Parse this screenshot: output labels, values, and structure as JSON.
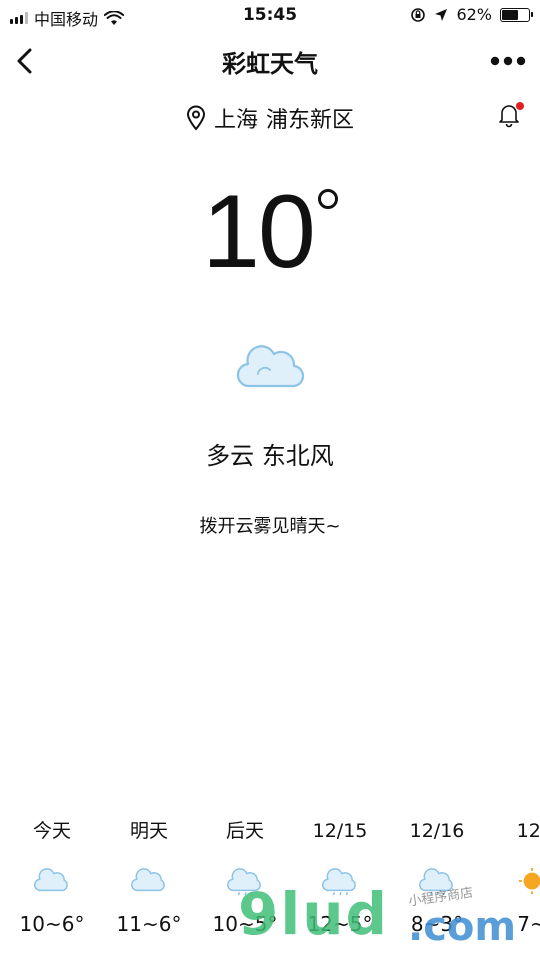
{
  "status_bar": {
    "carrier": "中国移动",
    "time": "15:45",
    "battery_percent": "62%",
    "battery_level": 0.62
  },
  "nav": {
    "title": "彩虹天气",
    "back_icon": "chevron-left-icon",
    "more_icon": "more-dots-icon"
  },
  "location": {
    "city": "上海",
    "district": "浦东新区"
  },
  "current": {
    "temperature": "10",
    "condition": "多云",
    "wind": "东北风",
    "quote": "拨开云雾见晴天~"
  },
  "forecast": [
    {
      "label": "今天",
      "icon": "cloud-icon",
      "range": "10~6°"
    },
    {
      "label": "明天",
      "icon": "cloud-icon",
      "range": "11~6°"
    },
    {
      "label": "后天",
      "icon": "rain-cloud-icon",
      "range": "10~5°"
    },
    {
      "label": "12/15",
      "icon": "rain-cloud-icon",
      "range": "12~5°"
    },
    {
      "label": "12/16",
      "icon": "rain-cloud-icon",
      "range": "8~3°"
    },
    {
      "label": "12/",
      "icon": "sun-icon",
      "range": "7~"
    }
  ],
  "watermark": {
    "digits": "9lud",
    "domain": ".com",
    "tagline": "小程序商店"
  },
  "colors": {
    "notification_dot": "#e02020",
    "cloud_fill": "#dff0fb",
    "cloud_stroke": "#8cc3e6",
    "sun": "#f5a623"
  }
}
